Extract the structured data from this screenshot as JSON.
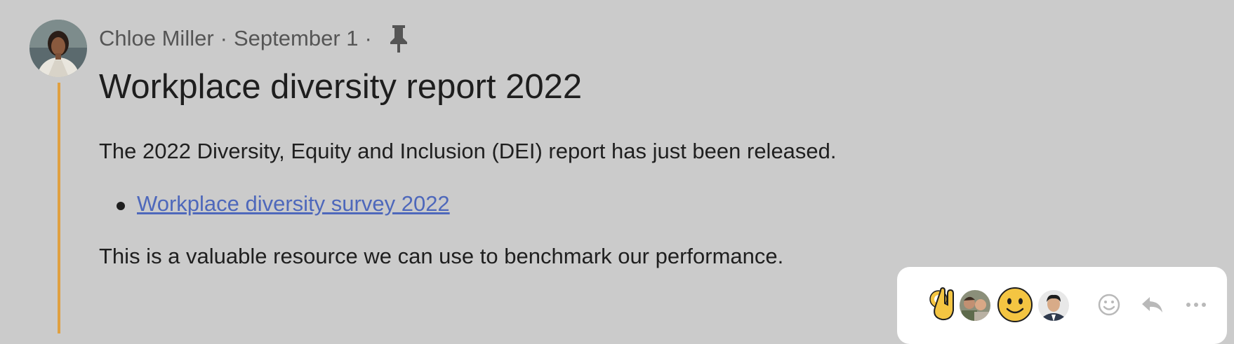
{
  "post": {
    "author": "Chloe Miller",
    "separator": "·",
    "date": "September 1",
    "title": "Workplace diversity report 2022",
    "paragraph_1": "The 2022 Diversity, Equity and Inclusion (DEI) report has just been released.",
    "link_text": "Workplace diversity survey 2022",
    "paragraph_2": "This is a valuable resource we can use to benchmark our performance."
  },
  "icons": {
    "pin": "pin-icon",
    "reactions": [
      "ok-hand-emoji",
      "user-avatar-group",
      "slightly-smiling-emoji",
      "user-avatar"
    ],
    "tools": [
      "add-reaction-icon",
      "reply-icon",
      "more-icon"
    ]
  },
  "colors": {
    "background": "#cbcbcb",
    "thread_line": "#e0a040",
    "link": "#4e68bb",
    "action_bar": "#ffffff"
  }
}
